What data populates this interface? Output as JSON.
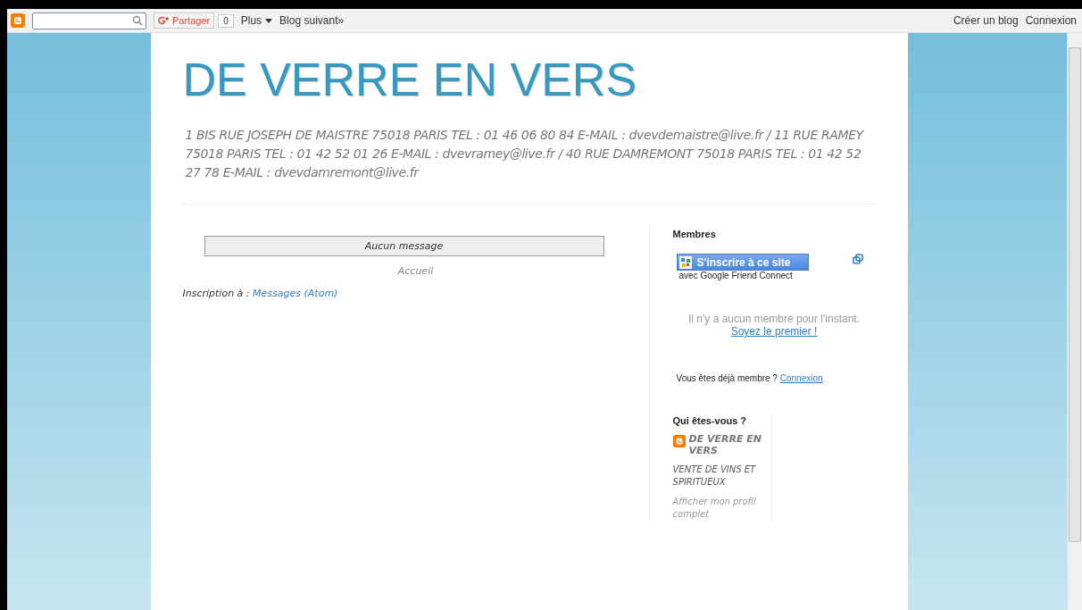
{
  "navbar": {
    "share": {
      "label": "Partager",
      "count": "0"
    },
    "more": "Plus",
    "next_blog": "Blog suivant»",
    "create_blog": "Créer un blog",
    "sign_in": "Connexion"
  },
  "header": {
    "title": "DE VERRE EN VERS",
    "description": "1 BIS RUE JOSEPH DE MAISTRE 75018 PARIS TEL : 01 46 06 80 84 E-MAIL : dvevdemaistre@live.fr / 11 RUE RAMEY 75018 PARIS TEL : 01 42 52 01 26 E-MAIL : dvevramey@live.fr / 40 RUE DAMREMONT 75018 PARIS TEL : 01 42 52 27 78 E-MAIL : dvevdamremont@live.fr"
  },
  "main": {
    "no_posts": "Aucun message",
    "home": "Accueil",
    "subscribe_label": "Inscription à :",
    "subscribe_link": "Messages (Atom)"
  },
  "members": {
    "title": "Membres",
    "join_button": "S'inscrire à ce site",
    "with_gfc": "avec Google Friend Connect",
    "empty": "Il n'y a aucun membre pour l'instant.",
    "be_first": "Soyez le premier !",
    "already": "Vous êtes déjà membre ?",
    "sign_in": "Connexion"
  },
  "profile": {
    "title": "Qui êtes-vous ?",
    "name": "DE VERRE EN VERS",
    "about": "VENTE DE VINS ET SPIRITUEUX",
    "view_full": "Afficher mon profil complet"
  }
}
